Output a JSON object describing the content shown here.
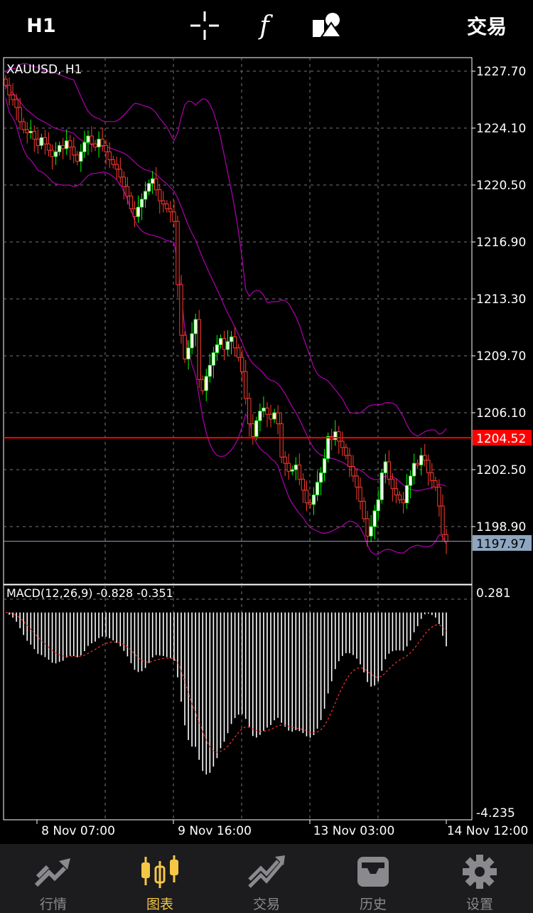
{
  "toolbar": {
    "timeframe": "H1",
    "function_symbol": "f",
    "trade_label": "交易"
  },
  "chart": {
    "symbol_label": "XAUUSD, H1",
    "bid_price": "1204.52",
    "last_price": "1197.97",
    "price_ticks": [
      "1227.70",
      "1224.10",
      "1220.50",
      "1216.90",
      "1213.30",
      "1209.70",
      "1206.10",
      "1202.50",
      "1198.90"
    ],
    "indicator_label": "MACD(12,26,9) -0.828 -0.351",
    "indicator_max": "0.281",
    "indicator_min": "-4.235",
    "time_labels": [
      "8 Nov 07:00",
      "9 Nov 16:00",
      "13 Nov 03:00",
      "14 Nov 12:00"
    ],
    "colors": {
      "bull": "#00ff00",
      "bear": "#ff3b30",
      "bands": "#b000b0",
      "bid_line": "#ff0000",
      "last_line": "#8fa6c0",
      "grid": "#777777",
      "histogram": "#ffffff",
      "signal": "#ff3030"
    }
  },
  "chart_data": {
    "type": "candlestick",
    "symbol": "XAUUSD",
    "timeframe": "H1",
    "ylim": [
      1196.0,
      1228.5
    ],
    "closes": [
      1226.8,
      1226.2,
      1225.9,
      1225.4,
      1224.5,
      1224.0,
      1223.8,
      1223.9,
      1223.4,
      1223.0,
      1223.5,
      1223.1,
      1222.7,
      1222.3,
      1222.6,
      1223.0,
      1222.8,
      1223.3,
      1222.9,
      1222.4,
      1222.0,
      1222.6,
      1223.2,
      1223.6,
      1223.1,
      1222.9,
      1223.4,
      1223.0,
      1222.6,
      1222.1,
      1221.8,
      1221.5,
      1221.0,
      1220.4,
      1219.8,
      1219.0,
      1218.5,
      1219.1,
      1219.6,
      1220.1,
      1220.6,
      1220.9,
      1220.2,
      1219.5,
      1219.3,
      1219.0,
      1218.8,
      1218.2,
      1214.2,
      1211.0,
      1209.5,
      1210.2,
      1211.1,
      1212.0,
      1208.2,
      1207.5,
      1208.4,
      1209.1,
      1209.9,
      1210.4,
      1210.8,
      1210.1,
      1210.6,
      1210.9,
      1210.2,
      1209.6,
      1208.7,
      1207.0,
      1205.4,
      1204.6,
      1205.6,
      1206.2,
      1206.4,
      1206.0,
      1205.7,
      1206.1,
      1205.4,
      1203.3,
      1202.9,
      1202.4,
      1202.5,
      1202.8,
      1201.9,
      1201.2,
      1200.4,
      1200.3,
      1200.9,
      1201.7,
      1202.3,
      1203.2,
      1204.6,
      1204.4,
      1204.9,
      1204.3,
      1203.9,
      1203.4,
      1202.7,
      1202.1,
      1201.4,
      1200.5,
      1199.4,
      1198.3,
      1198.9,
      1199.9,
      1200.6,
      1202.3,
      1203.0,
      1201.9,
      1201.3,
      1200.9,
      1200.6,
      1200.4,
      1201.5,
      1202.1,
      1202.9,
      1202.8,
      1203.4,
      1203.1,
      1202.3,
      1201.8,
      1201.4,
      1200.2,
      1198.4,
      1197.97
    ],
    "bid": 1204.52,
    "last": 1197.97,
    "indicator": {
      "name": "MACD(12,26,9)",
      "main": -0.828,
      "signal": -0.351,
      "range": [
        -4.235,
        0.281
      ]
    },
    "x_tick_labels": [
      "8 Nov 07:00",
      "9 Nov 16:00",
      "13 Nov 03:00",
      "14 Nov 12:00"
    ]
  },
  "nav": [
    {
      "label": "行情",
      "icon": "quotes-icon",
      "active": false
    },
    {
      "label": "图表",
      "icon": "chart-icon",
      "active": true
    },
    {
      "label": "交易",
      "icon": "trade-icon",
      "active": false
    },
    {
      "label": "历史",
      "icon": "history-icon",
      "active": false
    },
    {
      "label": "设置",
      "icon": "settings-icon",
      "active": false
    }
  ]
}
